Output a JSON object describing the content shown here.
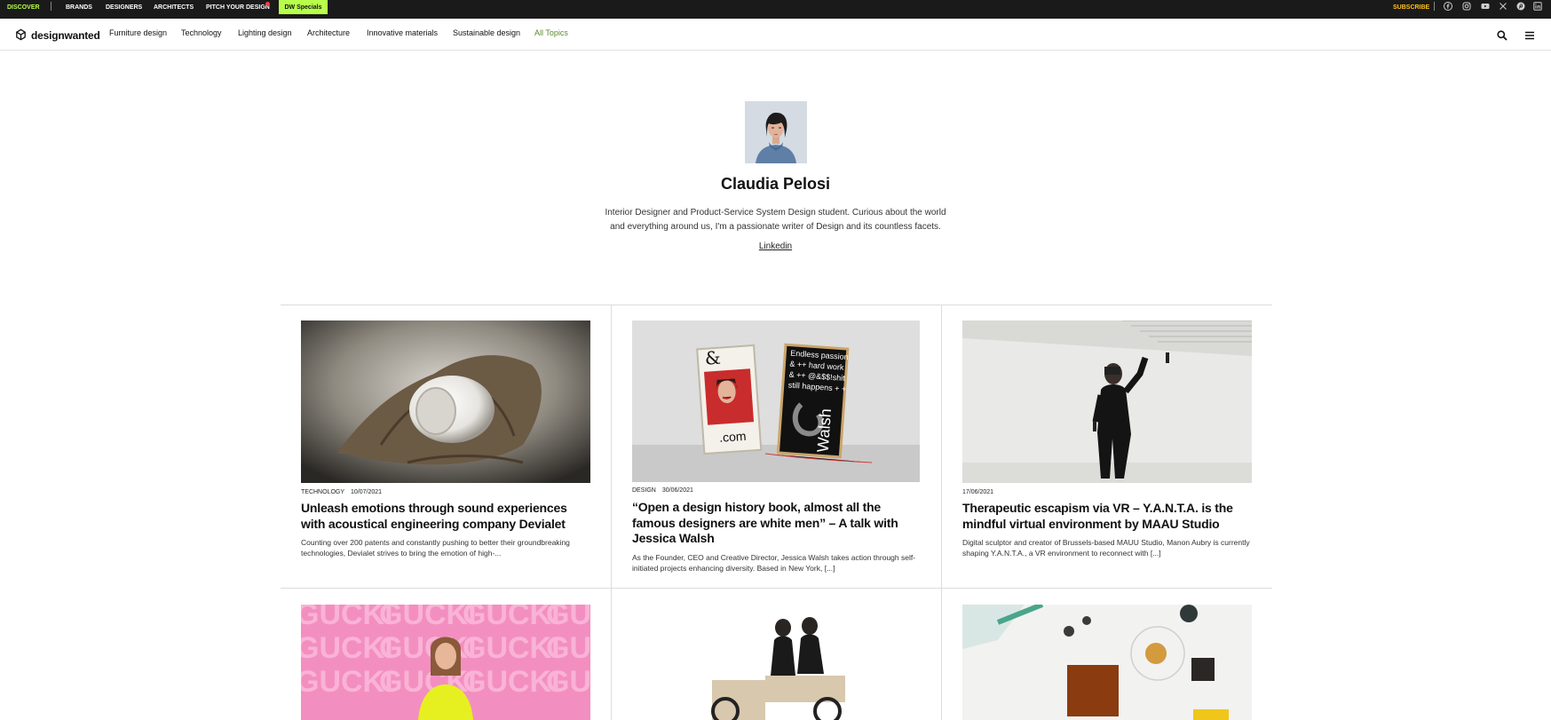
{
  "topbar": {
    "discover": "DISCOVER",
    "brands": "BRANDS",
    "designers": "DESIGNERS",
    "architects": "ARCHITECTS",
    "pitch": "PITCH YOUR DESIGN",
    "specials": "DW Specials",
    "subscribe": "SUBSCRIBE",
    "social_icons": [
      "facebook-icon",
      "instagram-icon",
      "youtube-icon",
      "x-icon",
      "pinterest-icon",
      "linkedin-icon"
    ],
    "colors": {
      "background": "#1a1a1a",
      "accent": "#b7ff4a",
      "subscribe": "#ffc21a"
    }
  },
  "nav": {
    "logo": "designwanted",
    "links": [
      "Furniture design",
      "Technology",
      "Lighting design",
      "Architecture",
      "Innovative materials",
      "Sustainable design"
    ],
    "all_topics": "All Topics",
    "icons": [
      "search-icon",
      "menu-icon"
    ]
  },
  "author": {
    "name": "Claudia Pelosi",
    "bio": "Interior Designer and Product-Service System Design student. Curious about the world and everything around us, I'm a passionate writer of Design and its countless facets.",
    "link": "Linkedin"
  },
  "articles": [
    {
      "category": "TECHNOLOGY",
      "date": "10/07/2021",
      "title": "Unleash emotions through sound experiences with acoustical engineering company Devialet",
      "excerpt": "Counting over 200 patents and constantly pushing to better their groundbreaking technologies, Devialet strives to bring the emotion of high-..."
    },
    {
      "category": "DESIGN",
      "date": "30/06/2021",
      "title": "“Open a design history book, almost all the famous designers are white men” – A talk with Jessica Walsh",
      "excerpt": "As the Founder, CEO and Creative Director, Jessica Walsh takes action through self-initiated projects enhancing diversity. Based in New York, [...]"
    },
    {
      "category": "",
      "date": "17/06/2021",
      "title": "Therapeutic escapism via VR – Y.A.N.T.A. is the mindful virtual environment by MAAU Studio",
      "excerpt": "Digital sculptor and creator of Brussels-based MAUU Studio, Manon Aubry is currently shaping Y.A.N.T.A., a VR environment to reconnect with [...]"
    }
  ],
  "images": {
    "poster_left_text": ".com",
    "poster_right_lines": [
      "Endless passion",
      "& ++ hard work",
      "& ++ @&$$!shit",
      "still happens + +"
    ],
    "poster_right_name": "Walsh",
    "gucki_word": "GUCKI"
  }
}
